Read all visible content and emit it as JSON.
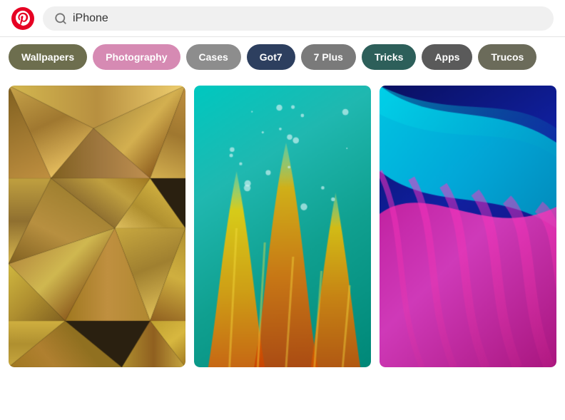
{
  "header": {
    "search_placeholder": "iPhone",
    "search_value": "iPhone"
  },
  "tags": [
    {
      "id": "wallpapers",
      "label": "Wallpapers",
      "class": "tag-wallpapers"
    },
    {
      "id": "photography",
      "label": "Photography",
      "class": "tag-photography"
    },
    {
      "id": "cases",
      "label": "Cases",
      "class": "tag-cases"
    },
    {
      "id": "got7",
      "label": "Got7",
      "class": "tag-got7"
    },
    {
      "id": "7plus",
      "label": "7 Plus",
      "class": "tag-7plus"
    },
    {
      "id": "tricks",
      "label": "Tricks",
      "class": "tag-tricks"
    },
    {
      "id": "apps",
      "label": "Apps",
      "class": "tag-apps"
    },
    {
      "id": "trucos",
      "label": "Trucos",
      "class": "tag-trucos"
    }
  ],
  "images": [
    {
      "id": "img1",
      "alt": "Gold geometric polygon wallpaper"
    },
    {
      "id": "img2",
      "alt": "Colorful abstract fluid paint art"
    },
    {
      "id": "img3",
      "alt": "Vibrant pink blue wave abstract"
    }
  ]
}
